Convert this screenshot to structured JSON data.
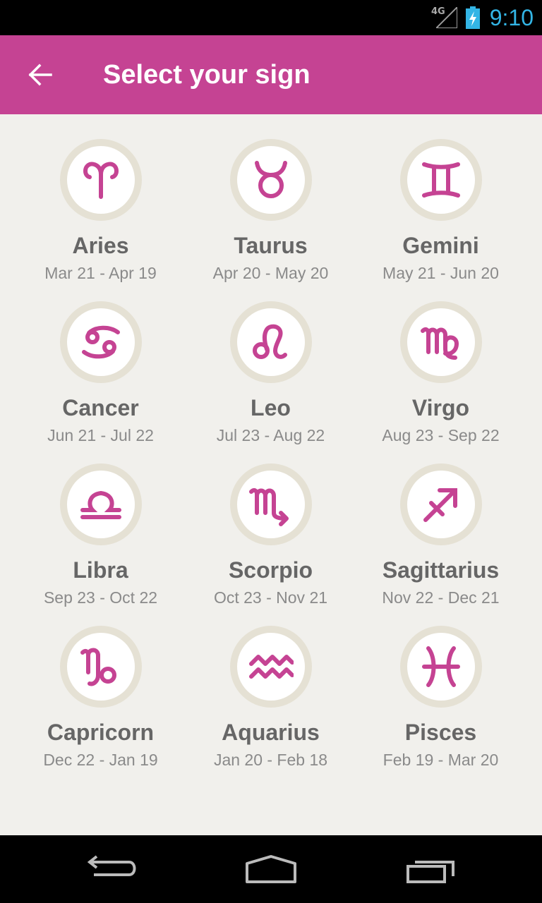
{
  "status_bar": {
    "network": "4G",
    "time": "9:10"
  },
  "app_bar": {
    "title": "Select your sign"
  },
  "accent_color": "#c54393",
  "signs": [
    {
      "name": "Aries",
      "dates": "Mar 21 - Apr 19",
      "icon": "aries-icon"
    },
    {
      "name": "Taurus",
      "dates": "Apr 20 - May 20",
      "icon": "taurus-icon"
    },
    {
      "name": "Gemini",
      "dates": "May 21 - Jun 20",
      "icon": "gemini-icon"
    },
    {
      "name": "Cancer",
      "dates": "Jun 21 - Jul 22",
      "icon": "cancer-icon"
    },
    {
      "name": "Leo",
      "dates": "Jul 23 - Aug 22",
      "icon": "leo-icon"
    },
    {
      "name": "Virgo",
      "dates": "Aug 23 - Sep 22",
      "icon": "virgo-icon"
    },
    {
      "name": "Libra",
      "dates": "Sep 23 - Oct 22",
      "icon": "libra-icon"
    },
    {
      "name": "Scorpio",
      "dates": "Oct 23 - Nov 21",
      "icon": "scorpio-icon"
    },
    {
      "name": "Sagittarius",
      "dates": "Nov 22 - Dec 21",
      "icon": "sagittarius-icon"
    },
    {
      "name": "Capricorn",
      "dates": "Dec 22 - Jan 19",
      "icon": "capricorn-icon"
    },
    {
      "name": "Aquarius",
      "dates": "Jan 20 - Feb 18",
      "icon": "aquarius-icon"
    },
    {
      "name": "Pisces",
      "dates": "Feb 19 - Mar 20",
      "icon": "pisces-icon"
    }
  ]
}
